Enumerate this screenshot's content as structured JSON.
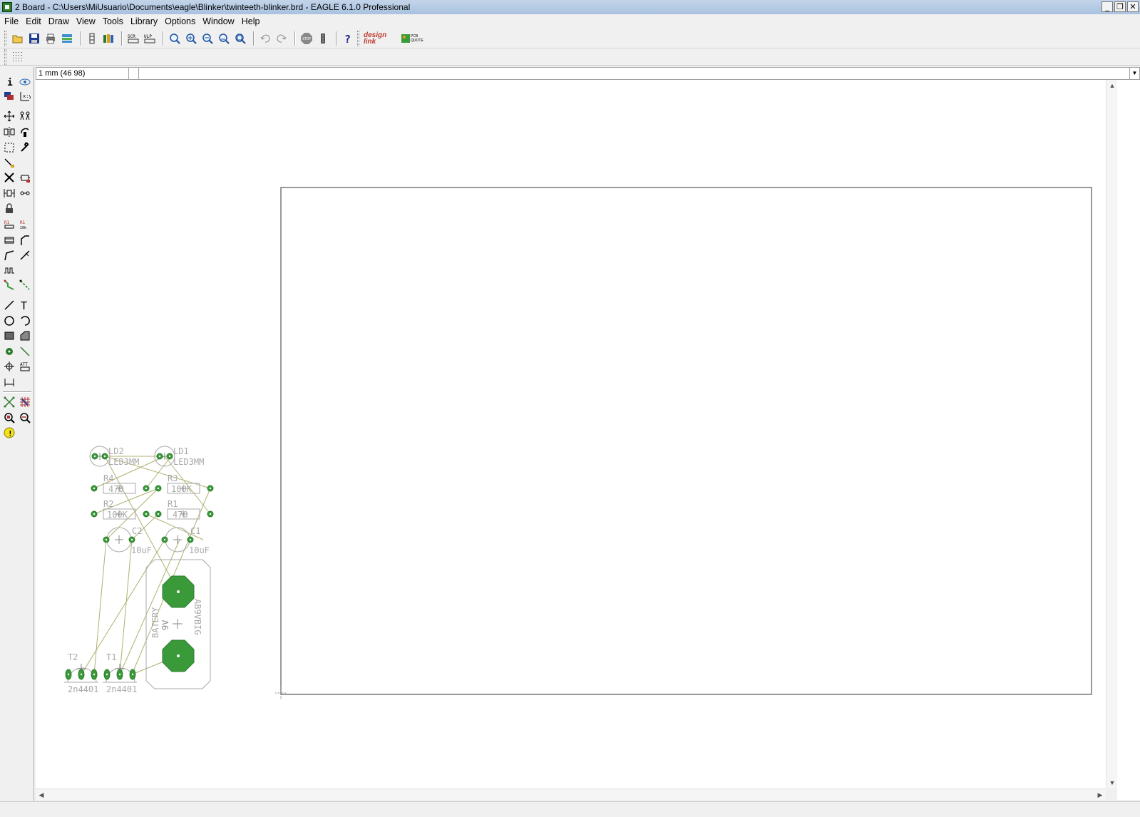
{
  "window": {
    "title": "2 Board - C:\\Users\\MiUsuario\\Documents\\eagle\\Blinker\\twinteeth-blinker.brd - EAGLE 6.1.0 Professional",
    "controls": [
      "minimize-icon",
      "restore-icon",
      "close-icon"
    ]
  },
  "menu": {
    "items": [
      "File",
      "Edit",
      "Draw",
      "View",
      "Tools",
      "Library",
      "Options",
      "Window",
      "Help"
    ]
  },
  "toolbar": {
    "buttons": [
      "open-icon",
      "save-icon",
      "print-icon",
      "cam-icon",
      "switch-icon",
      "library-icon",
      "script-icon",
      "ulp-icon",
      "zoom-fit-icon",
      "zoom-in-icon",
      "zoom-out-icon",
      "zoom-redraw-icon",
      "zoom-select-icon",
      "undo-icon",
      "redo-icon",
      "stop-icon",
      "go-icon",
      "help-icon"
    ],
    "design_link_label": "design link",
    "pcb_quote_label": "PCB QUOTE"
  },
  "commandbar": {
    "coordinate": "1 mm (46 98)",
    "input_value": ""
  },
  "left_tools": [
    "info-icon",
    "show-icon",
    "display-layers-icon",
    "mark-icon",
    "move-icon",
    "copy-icon",
    "mirror-icon",
    "rotate-icon",
    "group-icon",
    "change-icon",
    "paste-icon",
    "delete-icon",
    "add-icon",
    "replace-icon",
    "lock-icon",
    "name-icon",
    "value-icon",
    "smash-icon",
    "miter-icon",
    "split-icon",
    "optimize-icon",
    "meander-icon",
    "route-icon",
    "ripup-icon",
    "wire-icon",
    "text-icon",
    "circle-icon",
    "arc-icon",
    "rect-icon",
    "polygon-icon",
    "via-icon",
    "signal-icon",
    "hole-icon",
    "attribute-icon",
    "dimension-icon",
    "ratsnest-icon",
    "autorouter-icon",
    "drc-icon",
    "errors-icon",
    "erc-icon"
  ],
  "board": {
    "colors": {
      "pad": "#3a9a3a",
      "silk": "#a8a8a8",
      "airwire": "#b0b070",
      "outline": "#333333"
    },
    "parts": [
      {
        "name": "LD2",
        "value": "LED3MM"
      },
      {
        "name": "LD1",
        "value": "LED3MM"
      },
      {
        "name": "R4",
        "value": "470"
      },
      {
        "name": "R3",
        "value": "100K"
      },
      {
        "name": "R2",
        "value": "100K"
      },
      {
        "name": "R1",
        "value": "470"
      },
      {
        "name": "C2",
        "value": "10uF"
      },
      {
        "name": "C1",
        "value": "10uF"
      },
      {
        "name": "BATERY",
        "value": "9V",
        "package": "AB9VBIG"
      },
      {
        "name": "T2",
        "value": "2n4401"
      },
      {
        "name": "T1",
        "value": "2n4401"
      }
    ]
  }
}
